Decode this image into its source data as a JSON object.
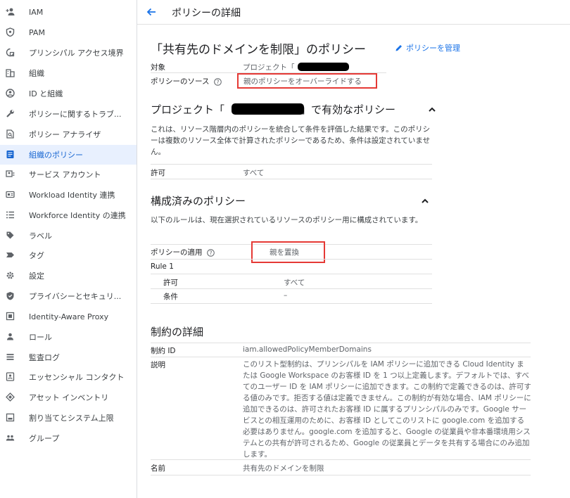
{
  "sidebar": {
    "items": [
      {
        "label": "IAM",
        "icon": "person-add-icon"
      },
      {
        "label": "PAM",
        "icon": "shield-icon"
      },
      {
        "label": "プリンシパル アクセス境界",
        "icon": "boundary-icon"
      },
      {
        "label": "組織",
        "icon": "organization-icon"
      },
      {
        "label": "ID と組織",
        "icon": "account-circle-icon"
      },
      {
        "label": "ポリシーに関するトラブ...",
        "icon": "wrench-icon"
      },
      {
        "label": "ポリシー アナライザ",
        "icon": "document-search-icon"
      },
      {
        "label": "組織のポリシー",
        "icon": "policy-document-icon"
      },
      {
        "label": "サービス アカウント",
        "icon": "service-account-icon"
      },
      {
        "label": "Workload Identity 連携",
        "icon": "workload-icon"
      },
      {
        "label": "Workforce Identity の連携",
        "icon": "list-icon"
      },
      {
        "label": "ラベル",
        "icon": "label-icon"
      },
      {
        "label": "タグ",
        "icon": "tag-icon"
      },
      {
        "label": "設定",
        "icon": "gear-icon"
      },
      {
        "label": "プライバシーとセキュリ...",
        "icon": "privacy-shield-icon"
      },
      {
        "label": "Identity-Aware Proxy",
        "icon": "proxy-icon"
      },
      {
        "label": "ロール",
        "icon": "role-icon"
      },
      {
        "label": "監査ログ",
        "icon": "audit-log-icon"
      },
      {
        "label": "エッセンシャル コンタクト",
        "icon": "contact-icon"
      },
      {
        "label": "アセット インベントリ",
        "icon": "inventory-icon"
      },
      {
        "label": "割り当てとシステム上限",
        "icon": "quota-icon"
      },
      {
        "label": "グループ",
        "icon": "group-icon"
      }
    ],
    "active_index": 7
  },
  "header": {
    "title": "ポリシーの詳細"
  },
  "policy": {
    "title": "「共有先のドメインを制限」のポリシー",
    "manage_label": "ポリシーを管理",
    "target_label": "対象",
    "target_value": "プロジェクト「",
    "source_label": "ポリシーのソース",
    "source_value": "親のポリシーをオーバーライドする"
  },
  "effective": {
    "title_prefix": "プロジェクト「",
    "title_suffix": "」で有効なポリシー",
    "description": "これは、リソース階層内のポリシーを統合して条件を評価した結果です。このポリシーは複数のリソース全体で計算されたポリシーであるため、条件は設定されていません。",
    "allow_label": "許可",
    "allow_value": "すべて"
  },
  "configured": {
    "title": "構成済みのポリシー",
    "description": "以下のルールは、現在選択されているリソースのポリシー用に構成されています。",
    "enforcement_label": "ポリシーの適用",
    "enforcement_value": "親を置換",
    "rule_label": "Rule 1",
    "allow_label": "許可",
    "allow_value": "すべて",
    "condition_label": "条件",
    "condition_value": "–"
  },
  "constraint": {
    "title": "制約の詳細",
    "id_label": "制約 ID",
    "id_value": "iam.allowedPolicyMemberDomains",
    "desc_label": "説明",
    "desc_value": "このリスト型制約は、プリンシパルを IAM ポリシーに追加できる Cloud Identity または Google Workspace のお客様 ID を 1 つ以上定義します。デフォルトでは、すべてのユーザー ID を IAM ポリシーに追加できます。この制約で定義できるのは、許可する値のみです。拒否する値は定義できません。この制約が有効な場合、IAM ポリシーに追加できるのは、許可されたお客様 ID に属するプリンシパルのみです。Google サービスとの相互運用のために、お客様 ID としてこのリストに google.com を追加する必要はありません。google.com を追加すると、Google の従業員や非本番環境用システムとの共有が許可されるため、Google の従業員とデータを共有する場合にのみ追加します。",
    "name_label": "名前",
    "name_value": "共有先のドメインを制限"
  },
  "colors": {
    "accent": "#1a73e8",
    "highlight_box": "#e53935",
    "active_bg": "#e8f0fe"
  }
}
